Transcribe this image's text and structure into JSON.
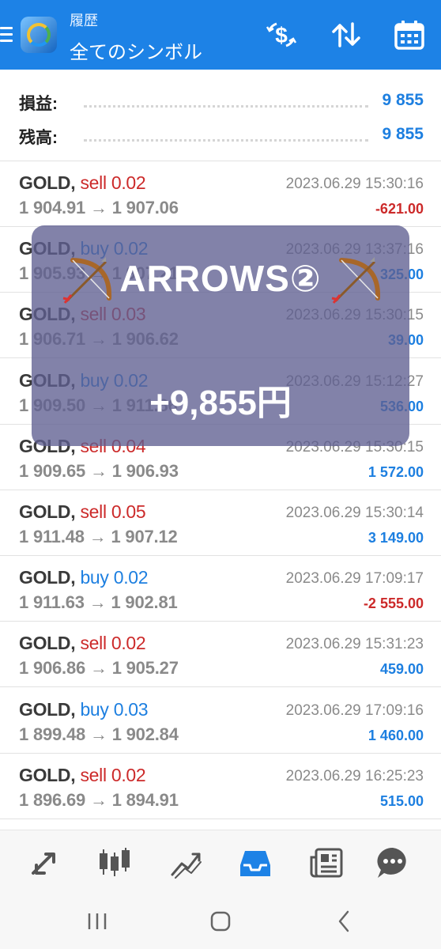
{
  "header": {
    "subtitle": "履歴",
    "title": "全てのシンボル",
    "icons": [
      "menu-icon",
      "app-logo",
      "currency-exchange-icon",
      "sort-arrows-icon",
      "calendar-icon"
    ]
  },
  "summary": [
    {
      "label": "損益:",
      "value": "9 855"
    },
    {
      "label": "残高:",
      "value": "9 855"
    }
  ],
  "trades": [
    {
      "symbol": "GOLD,",
      "side": "sell",
      "lot": "0.02",
      "open": "1 904.91",
      "close": "1 907.06",
      "time": "2023.06.29 15:30:16",
      "profit": "-621.00"
    },
    {
      "symbol": "GOLD,",
      "side": "buy",
      "lot": "0.02",
      "open": "1 905.93",
      "close": "1 907.21",
      "time": "2023.06.29 13:37:16",
      "profit": "325.00"
    },
    {
      "symbol": "GOLD,",
      "side": "sell",
      "lot": "0.03",
      "open": "1 906.71",
      "close": "1 906.62",
      "time": "2023.06.29 15:30:15",
      "profit": "39.00"
    },
    {
      "symbol": "GOLD,",
      "side": "buy",
      "lot": "0.02",
      "open": "1 909.50",
      "close": "1 911.86",
      "time": "2023.06.29 15:12:27",
      "profit": "536.00"
    },
    {
      "symbol": "GOLD,",
      "side": "sell",
      "lot": "0.04",
      "open": "1 909.65",
      "close": "1 906.93",
      "time": "2023.06.29 15:30:15",
      "profit": "1 572.00"
    },
    {
      "symbol": "GOLD,",
      "side": "sell",
      "lot": "0.05",
      "open": "1 911.48",
      "close": "1 907.12",
      "time": "2023.06.29 15:30:14",
      "profit": "3 149.00"
    },
    {
      "symbol": "GOLD,",
      "side": "buy",
      "lot": "0.02",
      "open": "1 911.63",
      "close": "1 902.81",
      "time": "2023.06.29 17:09:17",
      "profit": "-2 555.00"
    },
    {
      "symbol": "GOLD,",
      "side": "sell",
      "lot": "0.02",
      "open": "1 906.86",
      "close": "1 905.27",
      "time": "2023.06.29 15:31:23",
      "profit": "459.00"
    },
    {
      "symbol": "GOLD,",
      "side": "buy",
      "lot": "0.03",
      "open": "1 899.48",
      "close": "1 902.84",
      "time": "2023.06.29 17:09:16",
      "profit": "1 460.00"
    },
    {
      "symbol": "GOLD,",
      "side": "sell",
      "lot": "0.02",
      "open": "1 896.69",
      "close": "1 894.91",
      "time": "2023.06.29 16:25:23",
      "profit": "515.00"
    }
  ],
  "arrow": "→",
  "overlay": {
    "title": "ARROWS②",
    "amount": "+9,855円",
    "icons": [
      "bow-and-arrow-icon",
      "bow-and-arrow-icon"
    ]
  },
  "bottom_nav": {
    "items": [
      "quotes-icon",
      "chart-icon",
      "trade-icon",
      "history-icon",
      "news-icon",
      "chat-icon"
    ],
    "active": "history-icon",
    "active_color": "#1d82e6"
  },
  "system_nav": [
    "recents-icon",
    "home-icon",
    "back-icon"
  ],
  "colors": {
    "header": "#1d82e6",
    "profit_positive": "#1d7fe0",
    "profit_negative": "#cc2a2a",
    "sell": "#cc2a2a",
    "buy": "#1d7fe0"
  }
}
